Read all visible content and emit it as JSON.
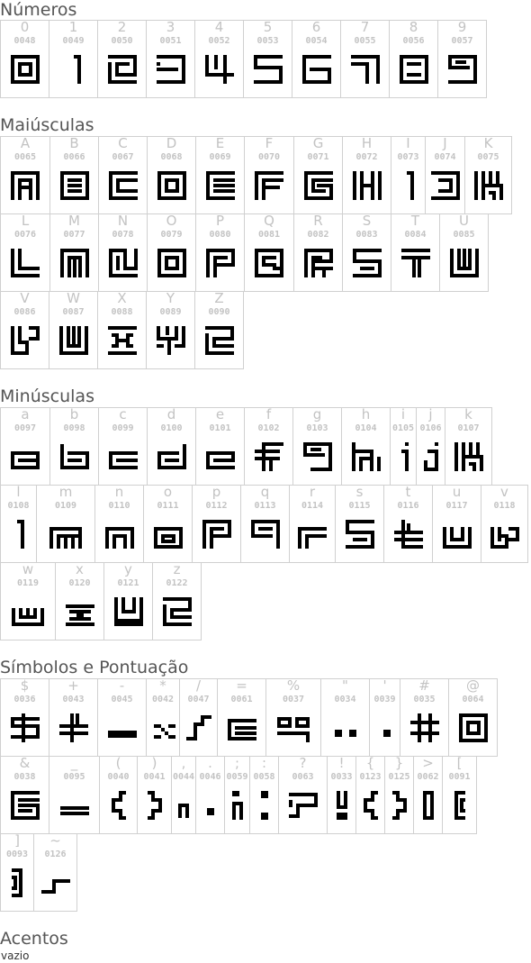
{
  "sections": [
    {
      "id": "numeros",
      "title": "Números",
      "rows": [
        [
          [
            "0",
            "0048",
            "d0"
          ],
          [
            "1",
            "0049",
            "d1"
          ],
          [
            "2",
            "0050",
            "d2"
          ],
          [
            "3",
            "0051",
            "d3"
          ],
          [
            "4",
            "0052",
            "d4"
          ],
          [
            "5",
            "0053",
            "d5"
          ],
          [
            "6",
            "0054",
            "d6"
          ],
          [
            "7",
            "0055",
            "d7"
          ],
          [
            "8",
            "0056",
            "d8"
          ],
          [
            "9",
            "0057",
            "d9"
          ]
        ]
      ]
    },
    {
      "id": "maiusculas",
      "title": "Maiúsculas",
      "rows": [
        [
          [
            "A",
            "0065",
            "uA"
          ],
          [
            "B",
            "0066",
            "uB"
          ],
          [
            "C",
            "0067",
            "uC"
          ],
          [
            "D",
            "0068",
            "uD"
          ],
          [
            "E",
            "0069",
            "uE"
          ],
          [
            "F",
            "0070",
            "uF"
          ],
          [
            "G",
            "0071",
            "uG"
          ],
          [
            "H",
            "0072",
            "uH"
          ],
          [
            "I",
            "0073",
            "uI"
          ],
          [
            "J",
            "0074",
            "uJ"
          ],
          [
            "K",
            "0075",
            "uK"
          ]
        ],
        [
          [
            "L",
            "0076",
            "uL"
          ],
          [
            "M",
            "0077",
            "uM"
          ],
          [
            "N",
            "0078",
            "uN"
          ],
          [
            "O",
            "0079",
            "uO"
          ],
          [
            "P",
            "0080",
            "uP"
          ],
          [
            "Q",
            "0081",
            "uQ"
          ],
          [
            "R",
            "0082",
            "uR"
          ],
          [
            "S",
            "0083",
            "uS"
          ],
          [
            "T",
            "0084",
            "uT"
          ],
          [
            "U",
            "0085",
            "uU"
          ]
        ],
        [
          [
            "V",
            "0086",
            "uV"
          ],
          [
            "W",
            "0087",
            "uW"
          ],
          [
            "X",
            "0088",
            "uX"
          ],
          [
            "Y",
            "0089",
            "uY"
          ],
          [
            "Z",
            "0090",
            "uZ"
          ]
        ]
      ]
    },
    {
      "id": "minusculas",
      "title": "Minúsculas",
      "rows": [
        [
          [
            "a",
            "0097",
            "la"
          ],
          [
            "b",
            "0098",
            "lb"
          ],
          [
            "c",
            "0099",
            "lc"
          ],
          [
            "d",
            "0100",
            "ld"
          ],
          [
            "e",
            "0101",
            "le"
          ],
          [
            "f",
            "0102",
            "lf"
          ],
          [
            "g",
            "0103",
            "lg"
          ],
          [
            "h",
            "0104",
            "lh"
          ],
          [
            "i",
            "0105",
            "li"
          ],
          [
            "j",
            "0106",
            "lj"
          ],
          [
            "k",
            "0107",
            "lk"
          ]
        ],
        [
          [
            "l",
            "0108",
            "ll"
          ],
          [
            "m",
            "0109",
            "lm"
          ],
          [
            "n",
            "0110",
            "ln"
          ],
          [
            "o",
            "0111",
            "lo"
          ],
          [
            "p",
            "0112",
            "lp"
          ],
          [
            "q",
            "0113",
            "lq"
          ],
          [
            "r",
            "0114",
            "lr"
          ],
          [
            "s",
            "0115",
            "ls"
          ],
          [
            "t",
            "0116",
            "lt"
          ],
          [
            "u",
            "0117",
            "lu"
          ],
          [
            "v",
            "0118",
            "lv"
          ]
        ],
        [
          [
            "w",
            "0119",
            "lw"
          ],
          [
            "x",
            "0120",
            "lx"
          ],
          [
            "y",
            "0121",
            "ly"
          ],
          [
            "z",
            "0122",
            "lz"
          ]
        ]
      ]
    },
    {
      "id": "simbolos",
      "title": "Símbolos e Pontuação",
      "rows": [
        [
          [
            "$",
            "0036",
            "sDollar"
          ],
          [
            "+",
            "0043",
            "sPlus"
          ],
          [
            "-",
            "0045",
            "sMinus"
          ],
          [
            "*",
            "0042",
            "sStar"
          ],
          [
            "/",
            "0047",
            "sSlash"
          ],
          [
            "=",
            "0061",
            "sEq"
          ],
          [
            "%",
            "0037",
            "sPct"
          ],
          [
            "\"",
            "0034",
            "sQuote"
          ],
          [
            "'",
            "0039",
            "sApos"
          ],
          [
            "#",
            "0035",
            "sHash"
          ],
          [
            "@",
            "0064",
            "sAt"
          ]
        ],
        [
          [
            "&",
            "0038",
            "sAmp"
          ],
          [
            "_",
            "0095",
            "sUnder"
          ],
          [
            "(",
            "0040",
            "sLpar"
          ],
          [
            ")",
            "0041",
            "sRpar"
          ],
          [
            ",",
            "0044",
            "sComma"
          ],
          [
            ".",
            "0046",
            "sDot"
          ],
          [
            ";",
            "0059",
            "sSemi"
          ],
          [
            ":",
            "0058",
            "sColon"
          ],
          [
            "?",
            "0063",
            "sQ"
          ],
          [
            "!",
            "0033",
            "sExcl"
          ],
          [
            "{",
            "0123",
            "sLbrace"
          ],
          [
            "}",
            "0125",
            "sRbrace"
          ],
          [
            ">",
            "0062",
            "sGt"
          ],
          [
            "[",
            "0091",
            "sLbrack"
          ]
        ],
        [
          [
            "]",
            "0093",
            "sRbrack"
          ],
          [
            "~",
            "0126",
            "sTilde"
          ]
        ]
      ]
    },
    {
      "id": "acentos",
      "title": "Acentos",
      "rows": []
    }
  ],
  "acentos_note": "vazio"
}
